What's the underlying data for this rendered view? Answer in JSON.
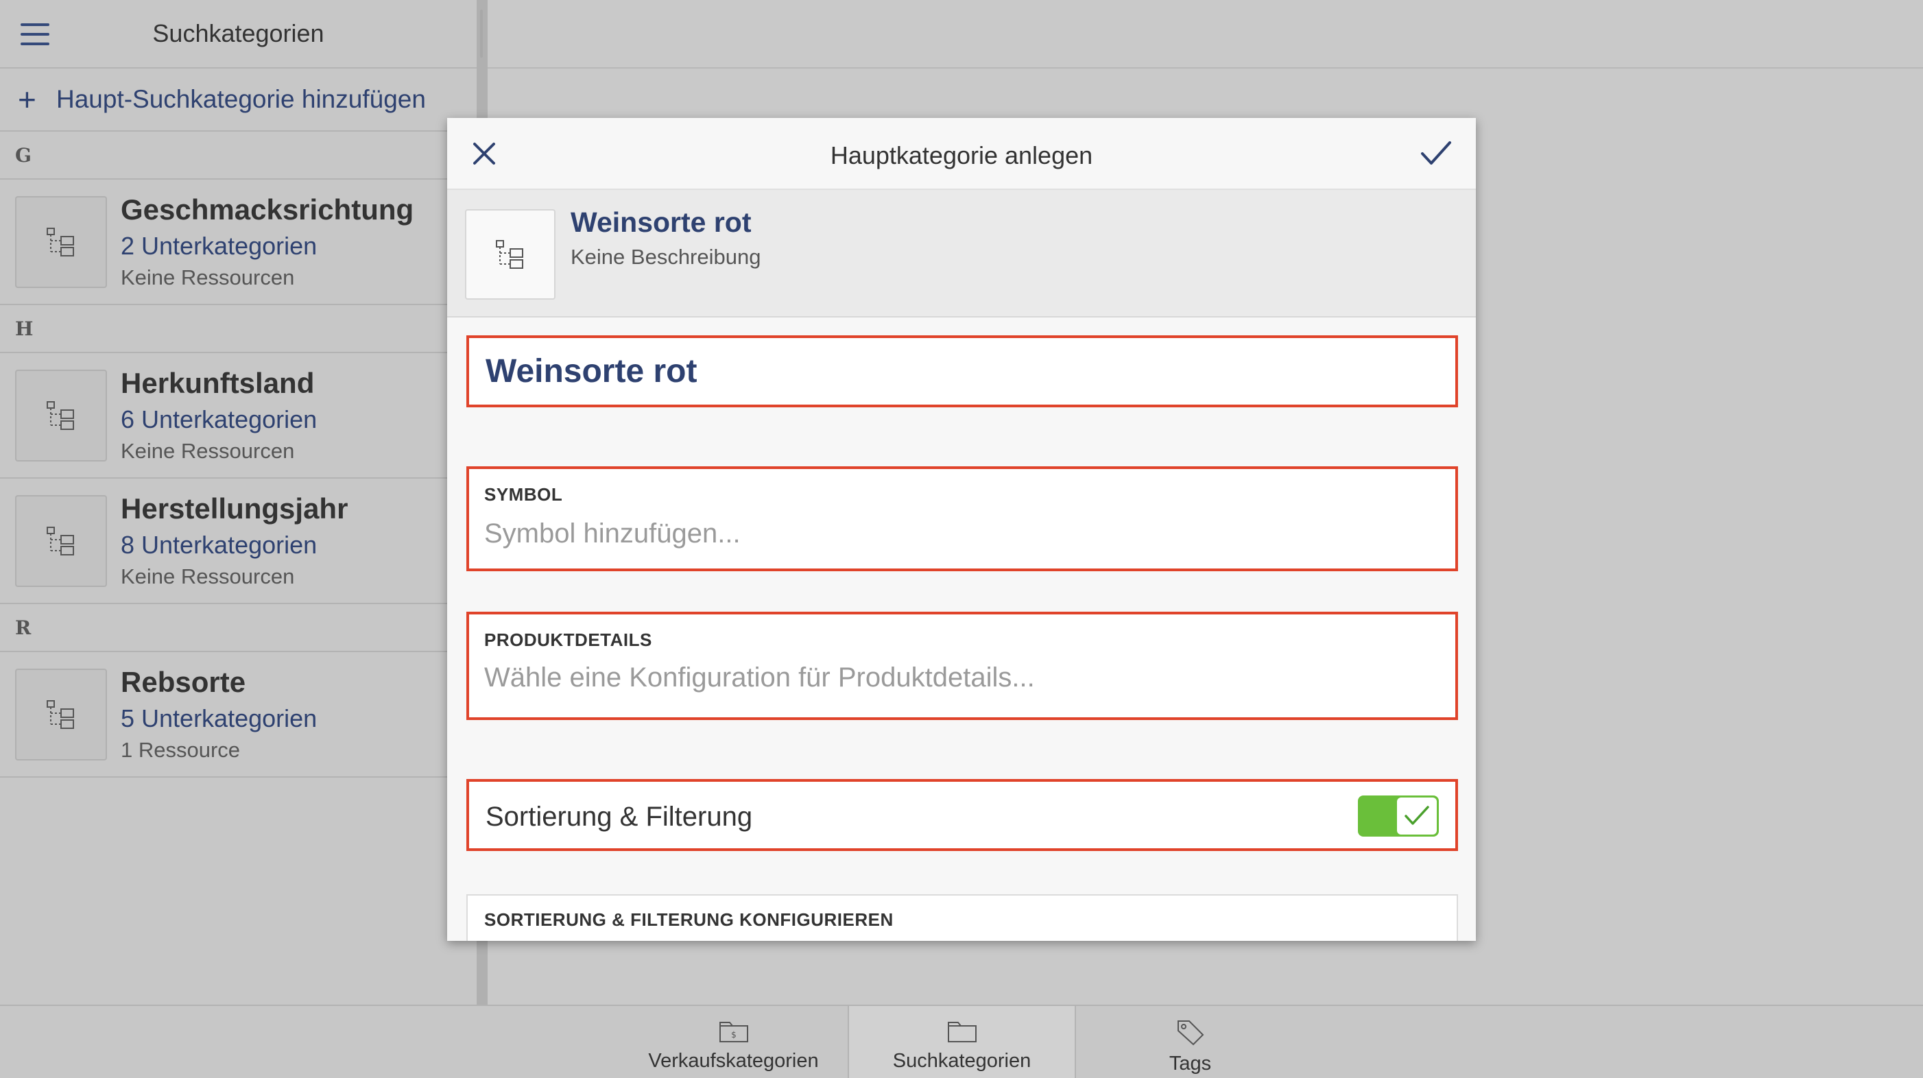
{
  "left_pane": {
    "title": "Suchkategorien",
    "add_button_label": "Haupt-Suchkategorie hinzufügen",
    "sections": [
      {
        "letter": "G",
        "items": [
          {
            "name": "Geschmacksrichtung",
            "subcategories": "2 Unterkategorien",
            "resources": "Keine Ressourcen"
          }
        ]
      },
      {
        "letter": "H",
        "items": [
          {
            "name": "Herkunftsland",
            "subcategories": "6 Unterkategorien",
            "resources": "Keine Ressourcen"
          },
          {
            "name": "Herstellungsjahr",
            "subcategories": "8 Unterkategorien",
            "resources": "Keine Ressourcen"
          }
        ]
      },
      {
        "letter": "R",
        "items": [
          {
            "name": "Rebsorte",
            "subcategories": "5 Unterkategorien",
            "resources": "1 Ressource"
          }
        ]
      }
    ]
  },
  "dialog": {
    "title": "Hauptkategorie anlegen",
    "preview": {
      "name": "Weinsorte rot",
      "description": "Keine Beschreibung"
    },
    "name_value": "Weinsorte rot",
    "symbol": {
      "label": "SYMBOL",
      "placeholder": "Symbol hinzufügen..."
    },
    "produktdetails": {
      "label": "PRODUKTDETAILS",
      "placeholder": "Wähle eine Konfiguration für Produktdetails..."
    },
    "sort_filter": {
      "label": "Sortierung & Filterung",
      "enabled": true
    },
    "sort_config_label": "SORTIERUNG & FILTERUNG KONFIGURIEREN"
  },
  "bottom_tabs": [
    {
      "label": "Verkaufskategorien",
      "icon": "folder-dollar-icon",
      "active": false
    },
    {
      "label": "Suchkategorien",
      "icon": "folder-icon",
      "active": true
    },
    {
      "label": "Tags",
      "icon": "tag-icon",
      "active": false
    }
  ],
  "colors": {
    "accent_blue": "#2e4170",
    "highlight_red": "#e0432a",
    "toggle_green": "#6abf3a"
  }
}
